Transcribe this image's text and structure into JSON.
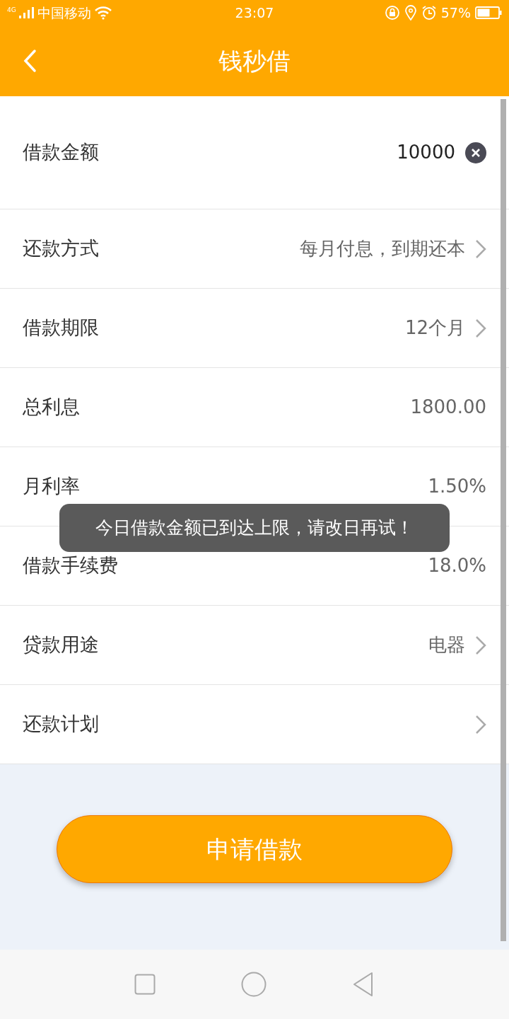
{
  "status_bar": {
    "network": "4G",
    "carrier": "中国移动",
    "time": "23:07",
    "battery": "57%"
  },
  "header": {
    "title": "钱秒借"
  },
  "rows": [
    {
      "kind": "clearable",
      "label": "借款金额",
      "value": "10000"
    },
    {
      "kind": "chevron",
      "label": "还款方式",
      "value": "每月付息，到期还本"
    },
    {
      "kind": "chevron",
      "label": "借款期限",
      "value": "12个月"
    },
    {
      "kind": "plain",
      "label": "总利息",
      "value": "1800.00"
    },
    {
      "kind": "plain",
      "label": "月利率",
      "value": "1.50%"
    },
    {
      "kind": "plain",
      "label": "借款手续费",
      "value": "18.0%"
    },
    {
      "kind": "chevron",
      "label": "贷款用途",
      "value": "电器"
    },
    {
      "kind": "chevron",
      "label": "还款计划"
    }
  ],
  "toast": "今日借款金额已到达上限，请改日再试！",
  "submit_button": "申请借款"
}
